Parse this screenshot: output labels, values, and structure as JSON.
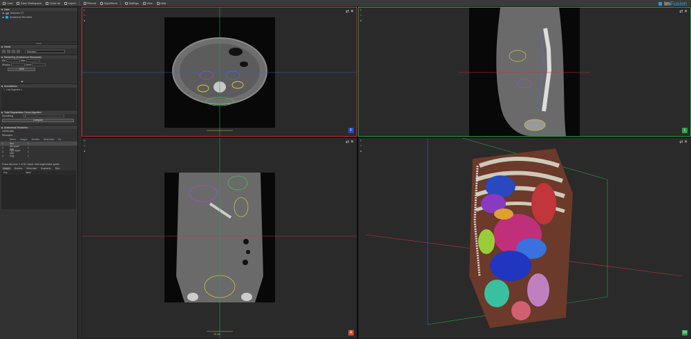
{
  "toolbar": {
    "items": [
      "Load",
      "Save Workspace",
      "Close all",
      "Import",
      "Record",
      "Algorithms",
      "Settings",
      "View",
      "Help"
    ],
    "brand_prefix": "Im",
    "brand_suffix": "Fusion"
  },
  "sidebar": {
    "data_panel_title": "Data",
    "data_items": [
      "Abdomen CT",
      "Anatomical Structures"
    ],
    "views_panel_title": "Views",
    "views_dropdown": "Standard",
    "rendering_title": "Rendering (Anatomical Structures)",
    "rendering_fields": [
      "Min",
      "Max",
      "Window",
      "Level"
    ],
    "rendering_value": "1000",
    "annotations_title": "Annotations",
    "annotations_item": "Line Segment 1",
    "tsa_title": "Total Segmentator Demo Algorithm",
    "tsa_field_label": "Smoothing",
    "tsa_field_value": "1",
    "compute_label": "Compute",
    "anat_title": "Anatomical Structures",
    "anat_subitems": [
      "Global data",
      "Structures"
    ],
    "table_headers": [
      "Name",
      "Images",
      "Borders",
      "Meta data",
      "Vis"
    ],
    "table_rows": [
      {
        "num": "1",
        "name": "liver",
        "images": "1"
      },
      {
        "num": "2",
        "name": "left upper lobe",
        "images": "1"
      },
      {
        "num": "3",
        "name": "right upper lobe",
        "images": "1"
      },
      {
        "num": "4",
        "name": "lung",
        "images": "1"
      }
    ],
    "focus_text": "Focus structure: 1 of 82, Name: total segmentator spleen",
    "focus_tabs": [
      "Images",
      "Borders",
      "Meta data",
      "Segments",
      "Misc"
    ],
    "kv_headers": [
      "Key",
      "Value"
    ]
  },
  "views": {
    "axial_badge": "F",
    "sagittal_badge": "L",
    "coronal_badge": "A",
    "render_badge": "3D",
    "scale_label": "10 cm",
    "colors": {
      "axial": "#c0363a",
      "sagittal": "#2aa14a",
      "coronal": "#d0502a",
      "render_badge": "#2aa14a",
      "axial_badge": "#2a48c0"
    }
  }
}
